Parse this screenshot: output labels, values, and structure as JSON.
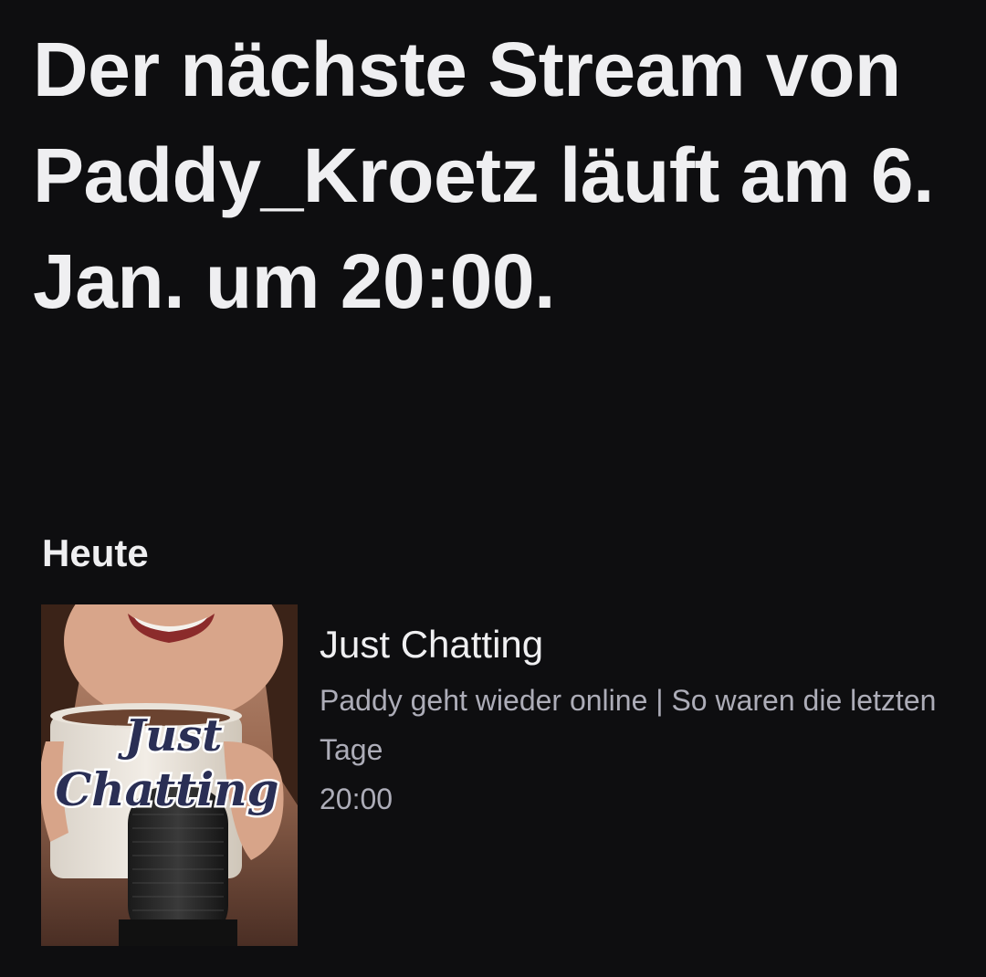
{
  "headline": "Der nächste Stream von Paddy_Kroetz läuft am 6. Jan. um 20:00.",
  "schedule": {
    "section_title": "Heute",
    "items": [
      {
        "thumbnail_icon": "just-chatting-thumbnail",
        "thumbnail_text_line1": "Just",
        "thumbnail_text_line2": "Chatting",
        "category": "Just Chatting",
        "title": "Paddy geht wieder online | So waren die letzten Tage",
        "time": "20:00"
      }
    ]
  },
  "colors": {
    "background": "#0e0e10",
    "primary_text": "#efeff1",
    "secondary_text": "#adadb8"
  }
}
